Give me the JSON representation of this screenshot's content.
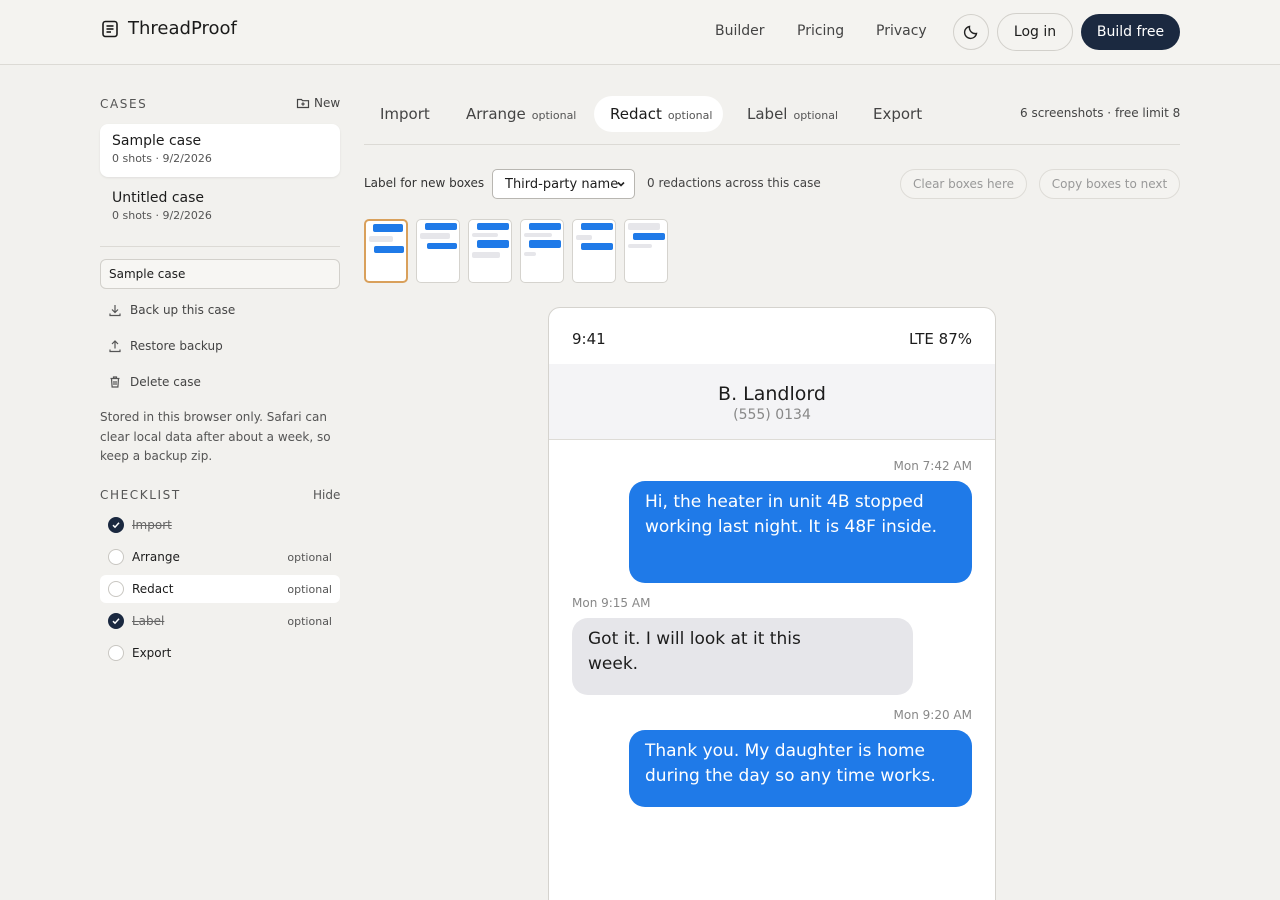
{
  "header": {
    "brand": "ThreadProof",
    "nav": [
      "Builder",
      "Pricing",
      "Privacy"
    ],
    "login": "Log in",
    "build": "Build free"
  },
  "sidebar": {
    "cases_title": "CASES",
    "new_label": "New",
    "cases": [
      {
        "title": "Sample case",
        "meta": "0 shots · 9/2/2026"
      },
      {
        "title": "Untitled case",
        "meta": "0 shots · 9/2/2026"
      }
    ],
    "case_name_value": "Sample case",
    "actions": [
      "Back up this case",
      "Restore backup",
      "Delete case"
    ],
    "storage_note": "Stored in this browser only. Safari can clear local data after about a week, so keep a backup zip.",
    "checklist_title": "CHECKLIST",
    "hide_label": "Hide",
    "checklist": [
      {
        "label": "Import",
        "optional": "",
        "done": true
      },
      {
        "label": "Arrange",
        "optional": "optional",
        "done": false
      },
      {
        "label": "Redact",
        "optional": "optional",
        "done": false
      },
      {
        "label": "Label",
        "optional": "optional",
        "done": true
      },
      {
        "label": "Export",
        "optional": "",
        "done": false
      }
    ]
  },
  "tabs": [
    {
      "label": "Import",
      "optional": ""
    },
    {
      "label": "Arrange",
      "optional": "optional"
    },
    {
      "label": "Redact",
      "optional": "optional"
    },
    {
      "label": "Label",
      "optional": "optional"
    },
    {
      "label": "Export",
      "optional": ""
    }
  ],
  "shots_info": "6 screenshots · free limit 8",
  "toolbar": {
    "label_for_new": "Label for new boxes",
    "label_select": "Third-party name",
    "redactions": "0 redactions across this case",
    "clear": "Clear boxes here",
    "copy": "Copy boxes to next"
  },
  "preview": {
    "time": "9:41",
    "network": "LTE 87%",
    "contact_name": "B. Landlord",
    "contact_phone": "(555) 0134",
    "messages": [
      {
        "time": "Mon 7:42 AM",
        "text": "Hi, the heater in unit 4B stopped working last night. It is 48F inside."
      },
      {
        "time": "Mon 9:15 AM",
        "text": "Got it. I will look at it this week."
      },
      {
        "time": "Mon 9:20 AM",
        "text": "Thank you. My daughter is home during the day so any time works."
      }
    ]
  },
  "colors": {
    "accent_dark": "#1b2940",
    "bubble_out": "#1f7ae8",
    "bubble_in": "#e6e6ea",
    "thumb_selected": "#d9a05b"
  }
}
